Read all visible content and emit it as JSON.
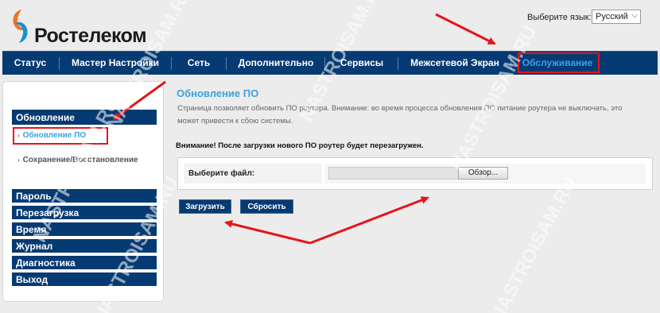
{
  "brand": {
    "name": "Ростелеком"
  },
  "language": {
    "label": "Выберите язык:",
    "selected": "Русский"
  },
  "nav": {
    "items": [
      {
        "label": "Статус"
      },
      {
        "label": "Мастер Настройки"
      },
      {
        "label": "Сеть"
      },
      {
        "label": "Дополнительно"
      },
      {
        "label": "Сервисы"
      },
      {
        "label": "Межсетевой Экран"
      },
      {
        "label": "Обслуживание",
        "active": true
      }
    ]
  },
  "sidebar": {
    "section": "Обновление",
    "subitems": [
      {
        "label": "Обновление ПО",
        "active": true
      },
      {
        "label": "Сохранение/Восстановление"
      }
    ],
    "items": [
      {
        "label": "Пароль"
      },
      {
        "label": "Перезагрузка"
      },
      {
        "label": "Время"
      },
      {
        "label": "Журнал"
      },
      {
        "label": "Диагностика"
      },
      {
        "label": "Выход"
      }
    ]
  },
  "content": {
    "title": "Обновление ПО",
    "description": "Страница позволяет обновить ПО роутера. Внимание: во время процесса обновления ПО питание роутера не выключать, это может привести к сбою системы.",
    "warning": "Внимание! После загрузки нового ПО роутер будет перезагружен.",
    "file_label": "Выберите файл:",
    "file_value": "",
    "browse_label": "Обзор...",
    "upload_label": "Загрузить",
    "reset_label": "Сбросить"
  },
  "watermark": "NASTROISAM.RU",
  "colors": {
    "nav_bg": "#063a72",
    "accent": "#3ba3dc",
    "highlight": "#e6141c"
  }
}
